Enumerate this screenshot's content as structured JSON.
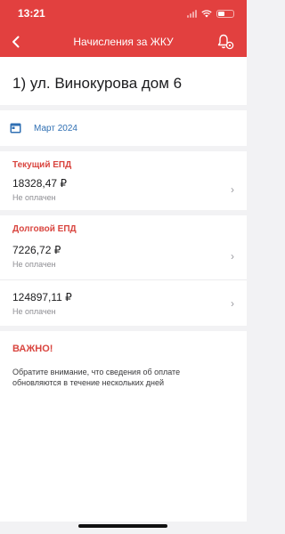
{
  "status_bar": {
    "time": "13:21",
    "battery_level": 0.45
  },
  "nav": {
    "title": "Начисления за ЖКУ",
    "back_icon": "chevron-left-icon",
    "bell_icon": "bell-settings-icon"
  },
  "address": {
    "text": "1) ул. Винокурова дом 6"
  },
  "period": {
    "label": "Март 2024",
    "icon": "calendar-icon"
  },
  "current_epd": {
    "title": "Текущий ЕПД",
    "items": [
      {
        "amount": "18328,47 ₽",
        "status": "Не оплачен"
      }
    ]
  },
  "debt_epd": {
    "title": "Долговой ЕПД",
    "items": [
      {
        "amount": "7226,72 ₽",
        "status": "Не оплачен"
      },
      {
        "amount": "124897,11 ₽",
        "status": "Не оплачен"
      }
    ]
  },
  "notice": {
    "title": "ВАЖНО!",
    "text": "Обратите внимание, что сведения об оплате обновляются в течение нескольких дней"
  },
  "colors": {
    "header": "#e2403f",
    "accent_blue": "#2f6fb3",
    "accent_red": "#d9453f"
  }
}
